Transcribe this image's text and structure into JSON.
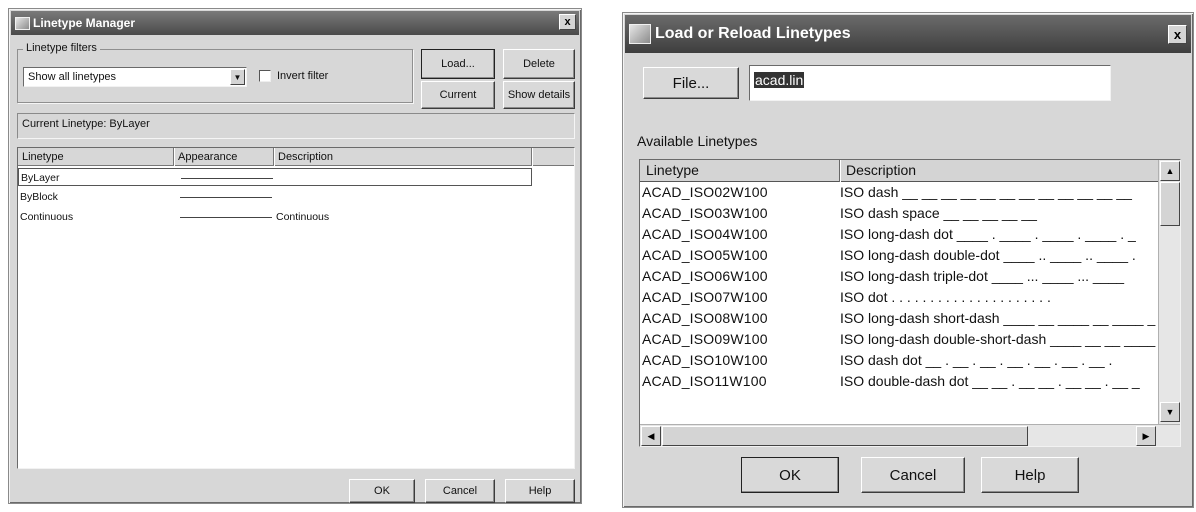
{
  "linetype_manager": {
    "title": "Linetype Manager",
    "close_glyph": "x",
    "filters_group_label": "Linetype filters",
    "filter_value": "Show all linetypes",
    "invert_filter_label": "Invert filter",
    "buttons": {
      "load": "Load...",
      "delete": "Delete",
      "current": "Current",
      "show_details": "Show details",
      "ok": "OK",
      "cancel": "Cancel",
      "help": "Help"
    },
    "current_linetype_label": "Current Linetype:  ByLayer",
    "columns": [
      "Linetype",
      "Appearance",
      "Description"
    ],
    "rows": [
      {
        "name": "ByLayer",
        "description": ""
      },
      {
        "name": "ByBlock",
        "description": ""
      },
      {
        "name": "Continuous",
        "description": "Continuous"
      }
    ],
    "selected_row": "ByLayer"
  },
  "load_reload": {
    "title": "Load or Reload Linetypes",
    "close_glyph": "x",
    "file_button": "File...",
    "file_value": "acad.lin",
    "available_label": "Available Linetypes",
    "columns": [
      "Linetype",
      "Description"
    ],
    "rows": [
      {
        "name": "ACAD_ISO02W100",
        "description": "ISO dash __ __ __ __ __ __ __ __ __ __ __ __"
      },
      {
        "name": "ACAD_ISO03W100",
        "description": "ISO dash space __    __    __    __    __"
      },
      {
        "name": "ACAD_ISO04W100",
        "description": "ISO long-dash dot ____ . ____ . ____ . ____ . _"
      },
      {
        "name": "ACAD_ISO05W100",
        "description": "ISO long-dash double-dot ____ .. ____ .. ____ ."
      },
      {
        "name": "ACAD_ISO06W100",
        "description": "ISO long-dash triple-dot ____ ... ____ ... ____"
      },
      {
        "name": "ACAD_ISO07W100",
        "description": "ISO dot . . . . . . . . . . . . . . . . . . . . ."
      },
      {
        "name": "ACAD_ISO08W100",
        "description": "ISO long-dash short-dash ____ __ ____ __ ____ _"
      },
      {
        "name": "ACAD_ISO09W100",
        "description": "ISO long-dash double-short-dash ____ __ __ ____"
      },
      {
        "name": "ACAD_ISO10W100",
        "description": "ISO dash dot __ . __ . __ . __ . __ . __ . __ ."
      },
      {
        "name": "ACAD_ISO11W100",
        "description": "ISO double-dash dot __ __ . __ __ . __ __ . __ _"
      }
    ],
    "buttons": {
      "ok": "OK",
      "cancel": "Cancel",
      "help": "Help"
    }
  }
}
